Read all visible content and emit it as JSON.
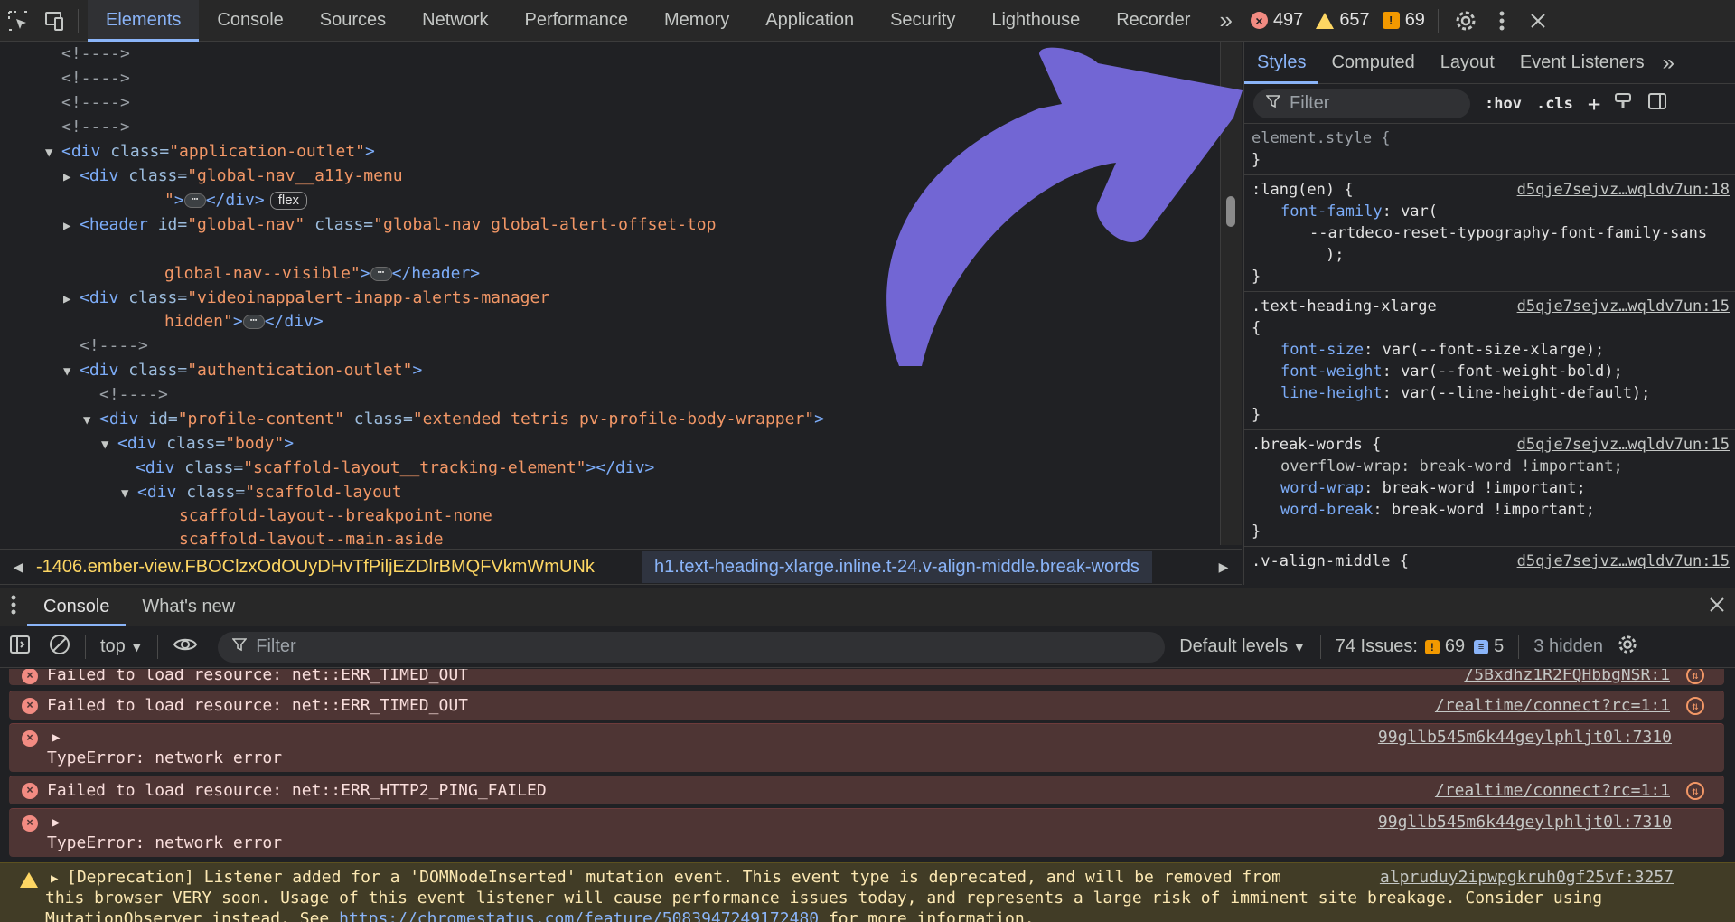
{
  "toolbar": {
    "tabs": [
      "Elements",
      "Console",
      "Sources",
      "Network",
      "Performance",
      "Memory",
      "Application",
      "Security",
      "Lighthouse",
      "Recorder"
    ],
    "more": "»",
    "errors": "497",
    "warnings": "657",
    "issues": "69"
  },
  "dom": {
    "comment": "<!---->",
    "l5_tag": "<div ",
    "l5_attr": "class=",
    "l5_val": "\"application-outlet\"",
    "l5_close": ">",
    "l6_tag": "<div ",
    "l6_attr": "class=",
    "l6_val": "\"global-nav__a11y-menu",
    "l7_val": "\"",
    "l7_tag": ">",
    "l7_close": "</div>",
    "l7_pill": "flex",
    "l8_tag": "<header ",
    "l8_attr1": "id=",
    "l8_val1": "\"global-nav\" ",
    "l8_attr2": "class=",
    "l8_val2": "\"global-nav global-alert-offset-top",
    "l9_val": "global-nav--visible\"",
    "l9_tag": ">",
    "l9_close": "</header>",
    "l10_tag": "<div ",
    "l10_attr": "class=",
    "l10_val": "\"videoinappalert-inapp-alerts-manager",
    "l11_val": "hidden\"",
    "l11_tag": ">",
    "l11_close": "</div>",
    "l13_tag": "<div ",
    "l13_attr": "class=",
    "l13_val": "\"authentication-outlet\"",
    "l13_close": ">",
    "l15_tag": "<div ",
    "l15_attr1": "id=",
    "l15_val1": "\"profile-content\" ",
    "l15_attr2": "class=",
    "l15_val2": "\"extended tetris pv-profile-body-wrapper\"",
    "l15_close": ">",
    "l16_tag": "<div ",
    "l16_attr": "class=",
    "l16_val": "\"body\"",
    "l16_close": ">",
    "l17_tag": "<div ",
    "l17_attr": "class=",
    "l17_val": "\"scaffold-layout__tracking-element\"",
    "l17_close": "></div>",
    "l18_tag": "<div ",
    "l18_attr": "class=",
    "l18_val": "\"scaffold-layout",
    "l19_val": "scaffold-layout--breakpoint-none",
    "l20_val": "scaffold-layout--main-aside"
  },
  "breadcrumb": {
    "item1": "-1406.ember-view.FBOClzxOdOUyDHvTfPiljEZDlrBMQFVkmWmUNk",
    "item2": "h1.text-heading-xlarge.inline.t-24.v-align-middle.break-words"
  },
  "styles": {
    "tabs": [
      "Styles",
      "Computed",
      "Layout",
      "Event Listeners"
    ],
    "more": "»",
    "filter_placeholder": "Filter",
    "hov": ":hov",
    "cls": ".cls",
    "r1_sel": "element.style {",
    "close": "}",
    "r2_sel": ":lang(en) {",
    "r2_src": "d5qje7sejvz…wqldv7un:18",
    "r2_p1n": "font-family",
    "r2_p1v": ": var(",
    "r2_p1v2": "--artdeco-reset-typography-font-family-sans",
    "r2_p1v3": ");",
    "r3_sel": ".text-heading-xlarge",
    "r3_brace": "{",
    "r3_src": "d5qje7sejvz…wqldv7un:15",
    "r3_p1n": "font-size",
    "r3_p1v": ": var(--font-size-xlarge);",
    "r3_p2n": "font-weight",
    "r3_p2v": ": var(--font-weight-bold);",
    "r3_p3n": "line-height",
    "r3_p3v": ": var(--line-height-default);",
    "r4_sel": ".break-words {",
    "r4_src": "d5qje7sejvz…wqldv7un:15",
    "r4_p1n": "overflow-wrap",
    "r4_p1v": ": break-word !important;",
    "r4_p2n": "word-wrap",
    "r4_p2v": ": break-word !important;",
    "r4_p3n": "word-break",
    "r4_p3v": ": break-word !important;",
    "r5_sel": ".v-align-middle {",
    "r5_src": "d5qje7sejvz…wqldv7un:15"
  },
  "drawer": {
    "tabs": [
      "Console",
      "What's new"
    ]
  },
  "console_toolbar": {
    "context": "top",
    "filter_placeholder": "Filter",
    "levels": "Default levels",
    "issues_label": "74 Issues:",
    "issues_warn": "69",
    "issues_info": "5",
    "hidden": "3 hidden"
  },
  "console": {
    "m0_text": "Failed to load resource: net::ERR_TIMED_OUT",
    "m0_src": "/5Bxdhz1R2FQHbbgNSR:1",
    "m1_text": "Failed to load resource: net::ERR_TIMED_OUT",
    "m1_src": "/realtime/connect?rc=1:1",
    "m2_text": "TypeError: network error",
    "m2_src": "99gllb545m6k44geylphljt0l:7310",
    "m3_text": "Failed to load resource: net::ERR_HTTP2_PING_FAILED",
    "m3_src": "/realtime/connect?rc=1:1",
    "m4_text": "TypeError: network error",
    "m4_src": "99gllb545m6k44geylphljt0l:7310",
    "m5_line1": "[Deprecation] Listener added for a 'DOMNodeInserted' mutation event. This event type is deprecated, and will be removed from",
    "m5_src": "alpruduy2ipwpgkruh0gf25vf:3257",
    "m5_line2": "this browser VERY soon. Usage of this event listener will cause performance issues today, and represents a large risk of imminent site breakage. Consider using",
    "m5_line3a": "MutationObserver instead. See ",
    "m5_link": "https://chromestatus.com/feature/5083947249172480",
    "m5_line3b": " for more information."
  },
  "colors": {
    "accent": "#8ab4f8",
    "arrow": "#7266d4",
    "error_bg": "#4e3534",
    "warn_bg": "#413c26"
  }
}
